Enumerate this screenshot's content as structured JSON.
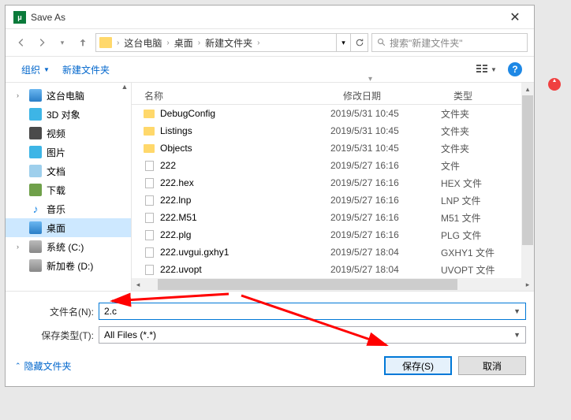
{
  "title": "Save As",
  "breadcrumb": [
    "这台电脑",
    "桌面",
    "新建文件夹"
  ],
  "search_placeholder": "搜索\"新建文件夹\"",
  "toolbar": {
    "organize": "组织",
    "new_folder": "新建文件夹"
  },
  "nav": {
    "items": [
      {
        "label": "这台电脑",
        "icon": "ni-computer",
        "chev": true
      },
      {
        "label": "3D 对象",
        "icon": "ni-3d"
      },
      {
        "label": "视频",
        "icon": "ni-video"
      },
      {
        "label": "图片",
        "icon": "ni-picture"
      },
      {
        "label": "文档",
        "icon": "ni-doc"
      },
      {
        "label": "下载",
        "icon": "ni-download"
      },
      {
        "label": "音乐",
        "icon": "ni-music",
        "glyph": "♪"
      },
      {
        "label": "桌面",
        "icon": "ni-desktop",
        "selected": true
      },
      {
        "label": "系统 (C:)",
        "icon": "ni-drive",
        "chev": true
      },
      {
        "label": "新加卷 (D:)",
        "icon": "ni-drive"
      }
    ]
  },
  "columns": {
    "name": "名称",
    "date": "修改日期",
    "type": "类型"
  },
  "files": [
    {
      "name": "DebugConfig",
      "date": "2019/5/31 10:45",
      "type": "文件夹",
      "kind": "folder"
    },
    {
      "name": "Listings",
      "date": "2019/5/31 10:45",
      "type": "文件夹",
      "kind": "folder"
    },
    {
      "name": "Objects",
      "date": "2019/5/31 10:45",
      "type": "文件夹",
      "kind": "folder"
    },
    {
      "name": "222",
      "date": "2019/5/27 16:16",
      "type": "文件",
      "kind": "file"
    },
    {
      "name": "222.hex",
      "date": "2019/5/27 16:16",
      "type": "HEX 文件",
      "kind": "file"
    },
    {
      "name": "222.lnp",
      "date": "2019/5/27 16:16",
      "type": "LNP 文件",
      "kind": "file"
    },
    {
      "name": "222.M51",
      "date": "2019/5/27 16:16",
      "type": "M51 文件",
      "kind": "file"
    },
    {
      "name": "222.plg",
      "date": "2019/5/27 16:16",
      "type": "PLG 文件",
      "kind": "file"
    },
    {
      "name": "222.uvgui.gxhy1",
      "date": "2019/5/27 18:04",
      "type": "GXHY1 文件",
      "kind": "file"
    },
    {
      "name": "222.uvopt",
      "date": "2019/5/27 18:04",
      "type": "UVOPT 文件",
      "kind": "file"
    }
  ],
  "filename_label": "文件名(N):",
  "filename_value": "2.c",
  "filetype_label": "保存类型(T):",
  "filetype_value": "All Files (*.*)",
  "hide_folders": "隐藏文件夹",
  "save_btn": "保存(S)",
  "cancel_btn": "取消"
}
